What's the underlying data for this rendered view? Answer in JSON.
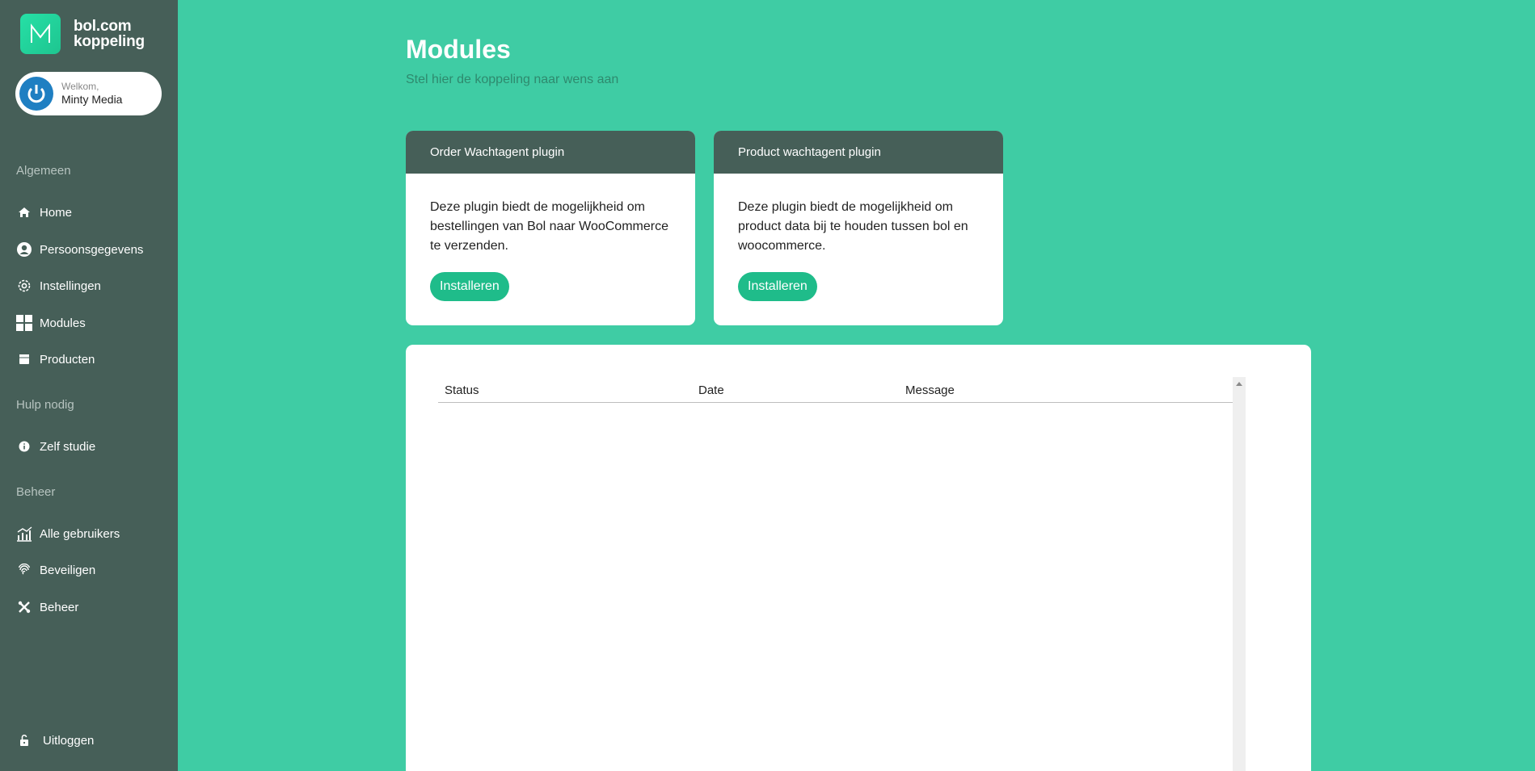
{
  "brand": {
    "line1": "bol.com",
    "line2": "koppeling",
    "logo_letter": "M"
  },
  "user": {
    "greeting": "Welkom,",
    "name": "Minty Media"
  },
  "sidebar": {
    "sections": [
      {
        "title": "Algemeen"
      },
      {
        "title": "Hulp nodig"
      },
      {
        "title": "Beheer"
      }
    ],
    "items": [
      {
        "label": "Home",
        "icon": "home-icon"
      },
      {
        "label": "Persoonsgegevens",
        "icon": "user-circle-icon"
      },
      {
        "label": "Instellingen",
        "icon": "gear-icon"
      },
      {
        "label": "Modules",
        "icon": "grid-icon"
      },
      {
        "label": "Producten",
        "icon": "box-icon"
      },
      {
        "label": "Zelf studie",
        "icon": "info-icon"
      },
      {
        "label": "Alle gebruikers",
        "icon": "chart-icon"
      },
      {
        "label": "Beveiligen",
        "icon": "fingerprint-icon"
      },
      {
        "label": "Beheer",
        "icon": "tools-icon"
      }
    ],
    "logout": {
      "label": "Uitloggen",
      "icon": "unlock-icon"
    }
  },
  "page": {
    "title": "Modules",
    "subtitle": "Stel hier de koppeling naar wens aan"
  },
  "cards": [
    {
      "title": "Order Wachtagent plugin",
      "lines": [
        "Deze plugin biedt de mogelijkheid om",
        "bestellingen van Bol naar WooCommerce",
        "te verzenden."
      ],
      "button": "Installeren"
    },
    {
      "title": "Product wachtagent plugin",
      "lines": [
        "Deze plugin biedt de mogelijkheid om",
        "product data bij te houden tussen bol en",
        "woocommerce."
      ],
      "button": "Installeren"
    }
  ],
  "table": {
    "columns": [
      "Status",
      "Date",
      "Message"
    ]
  },
  "colors": {
    "background": "#3fcca4",
    "sidebar": "#465f58",
    "accent": "#1fbc8a"
  }
}
